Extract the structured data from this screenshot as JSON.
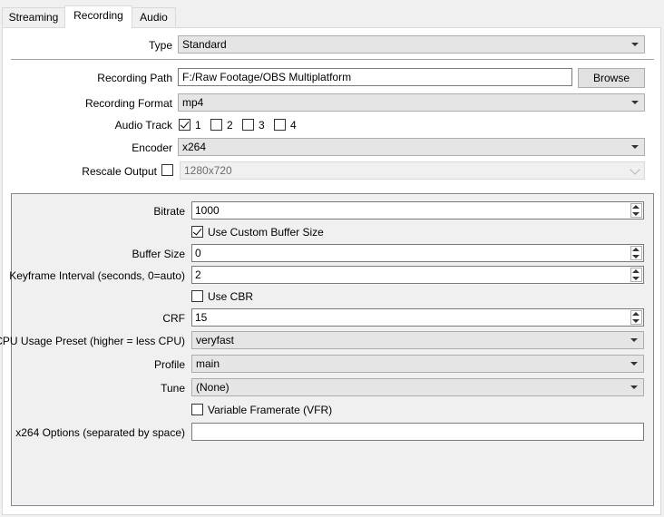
{
  "tabs": [
    {
      "label": "Streaming"
    },
    {
      "label": "Recording"
    },
    {
      "label": "Audio"
    }
  ],
  "recording": {
    "type_label": "Type",
    "type_value": "Standard",
    "path_label": "Recording Path",
    "path_value": "F:/Raw Footage/OBS Multiplatform",
    "browse_label": "Browse",
    "format_label": "Recording Format",
    "format_value": "mp4",
    "audio_track_label": "Audio Track",
    "audio_tracks": [
      {
        "label": "1",
        "checked": true
      },
      {
        "label": "2",
        "checked": false
      },
      {
        "label": "3",
        "checked": false
      },
      {
        "label": "4",
        "checked": false
      }
    ],
    "encoder_label": "Encoder",
    "encoder_value": "x264",
    "rescale_label": "Rescale Output",
    "rescale_checked": false,
    "rescale_value": "1280x720"
  },
  "encoder_settings": {
    "bitrate_label": "Bitrate",
    "bitrate_value": "1000",
    "custom_buffer_label": "Use Custom Buffer Size",
    "custom_buffer_checked": true,
    "buffer_size_label": "Buffer Size",
    "buffer_size_value": "0",
    "keyframe_label": "Keyframe Interval (seconds, 0=auto)",
    "keyframe_value": "2",
    "use_cbr_label": "Use CBR",
    "use_cbr_checked": false,
    "crf_label": "CRF",
    "crf_value": "15",
    "cpu_preset_label": "CPU Usage Preset (higher = less CPU)",
    "cpu_preset_value": "veryfast",
    "profile_label": "Profile",
    "profile_value": "main",
    "tune_label": "Tune",
    "tune_value": "(None)",
    "vfr_label": "Variable Framerate (VFR)",
    "vfr_checked": false,
    "x264_options_label": "x264 Options (separated by space)",
    "x264_options_value": ""
  }
}
